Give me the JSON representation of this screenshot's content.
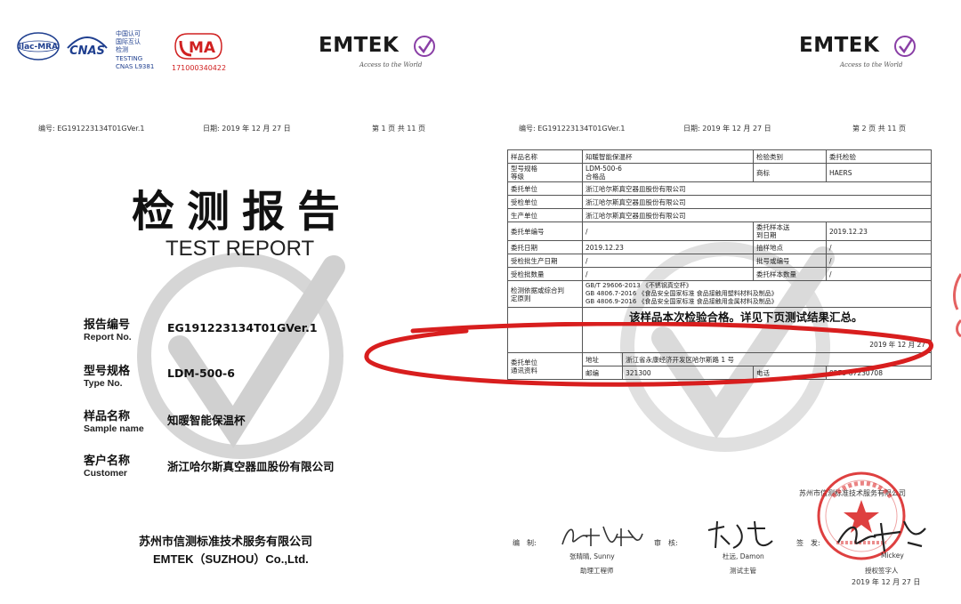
{
  "logos": {
    "ilac_text": "ilac-MRA",
    "cnas_text": "CNAS",
    "cnas_lines": [
      "中国认可",
      "国际互认",
      "检测",
      "TESTING",
      "CNAS L9381"
    ],
    "cma_text": "MA",
    "cma_number": "171000340422"
  },
  "brand": {
    "name": "EMTEK",
    "slogan": "Access to the World"
  },
  "left_page": {
    "header": {
      "report_id": "编号: EG191223134T01GVer.1",
      "date": "日期: 2019 年 12 月 27 日",
      "page": "第 1 页 共 11 页"
    },
    "title_cn": "检测报告",
    "title_en": "TEST REPORT",
    "fields": [
      {
        "label_cn": "报告编号",
        "label_en": "Report No.",
        "value": "EG191223134T01GVer.1"
      },
      {
        "label_cn": "型号规格",
        "label_en": "Type No.",
        "value": "LDM-500-6"
      },
      {
        "label_cn": "样品名称",
        "label_en": "Sample name",
        "value": "知暖智能保温杯"
      },
      {
        "label_cn": "客户名称",
        "label_en": "Customer",
        "value": "浙江哈尔斯真空器皿股份有限公司"
      }
    ],
    "footer_cn": "苏州市信测标准技术服务有限公司",
    "footer_en": "EMTEK（SUZHOU）Co.,Ltd."
  },
  "right_page": {
    "header": {
      "report_id": "编号: EG191223134T01GVer.1",
      "date": "日期: 2019 年 12 月 27 日",
      "page": "第 2 页 共 11 页"
    },
    "table": {
      "sample_name_label": "样品名称",
      "sample_name": "知暖智能保温杯",
      "test_type_label": "检验类别",
      "test_type": "委托检验",
      "model_label": "型号规格\n等级",
      "model": "LDM-500-6\n合格品",
      "trademark_label": "商标",
      "trademark": "HAERS",
      "client_label": "委托单位",
      "client": "浙江哈尔斯真空器皿股份有限公司",
      "inspected_label": "受检单位",
      "inspected": "浙江哈尔斯真空器皿股份有限公司",
      "producer_label": "生产单位",
      "producer": "浙江哈尔斯真空器皿股份有限公司",
      "order_no_label": "委托单编号",
      "order_no": "/",
      "arrival_label": "委托样本送\n到日期",
      "arrival": "2019.12.23",
      "commission_date_label": "委托日期",
      "commission_date": "2019.12.23",
      "sampling_place_label": "抽样地点",
      "sampling_place": "/",
      "prod_date_label": "受检批生产日期",
      "prod_date": "/",
      "batch_no_label": "批号或编号",
      "batch_no": "/",
      "batch_qty_label": "受检批数量",
      "batch_qty": "/",
      "sample_qty_label": "委托样本数量",
      "sample_qty": "/",
      "basis_label": "检测依据或综合判\n定原则",
      "basis_lines": [
        "GB/T 29606-2013 《不锈钢真空杯》",
        "GB 4806.7-2016 《食品安全国家标准 食品接触用塑料材料及制品》",
        "GB 4806.9-2016 《食品安全国家标准 食品接触用金属材料及制品》"
      ],
      "conclusion": "该样品本次检验合格。详见下页测试结果汇总。",
      "conclusion_date": "2019 年 12 月 27",
      "contact_label": "委托单位\n通讯资料",
      "address_label": "地址",
      "address": "浙江省永康经济开发区哈尔斯路 1 号",
      "postcode_label": "邮编",
      "postcode": "321300",
      "phone_label": "电话",
      "phone": "0579-87230708"
    },
    "issuer": "苏州市信测标准技术服务有限公司",
    "signatures": {
      "prepared_label": "编　制:",
      "prepared_name": "张晴晴, Sunny",
      "prepared_title": "助理工程师",
      "reviewed_label": "审　核:",
      "reviewed_name": "杜远, Damon",
      "reviewed_title": "测试主管",
      "approved_label": "签　发:",
      "approved_name": "Mickey",
      "approved_title": "授权签字人",
      "approved_date": "2019 年 12 月 27 日"
    }
  },
  "colors": {
    "stamp_red": "#d81e1e",
    "emtek_purple": "#8a3fa6",
    "cnas_blue": "#1f3f8f"
  }
}
